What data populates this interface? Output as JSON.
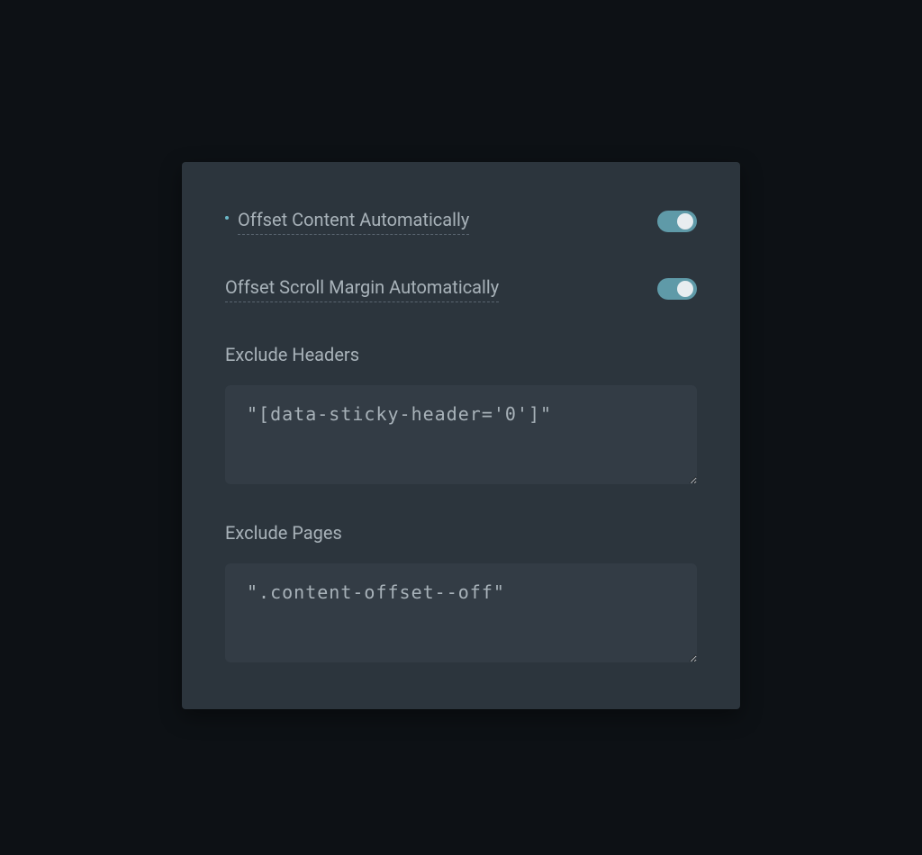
{
  "settings": {
    "offsetContent": {
      "label": "Offset Content Automatically",
      "enabled": true,
      "hasBullet": true
    },
    "offsetScrollMargin": {
      "label": "Offset Scroll Margin Automatically",
      "enabled": true,
      "hasBullet": false
    },
    "excludeHeaders": {
      "label": "Exclude Headers",
      "value": "\"[data-sticky-header='0']\""
    },
    "excludePages": {
      "label": "Exclude Pages",
      "value": "\".content-offset--off\""
    }
  },
  "colors": {
    "background": "#0d1115",
    "panel": "#2c353d",
    "textarea": "#333c45",
    "text": "#a8b2b9",
    "toggle": "#5f9aa8",
    "accent": "#6bb8c8"
  }
}
